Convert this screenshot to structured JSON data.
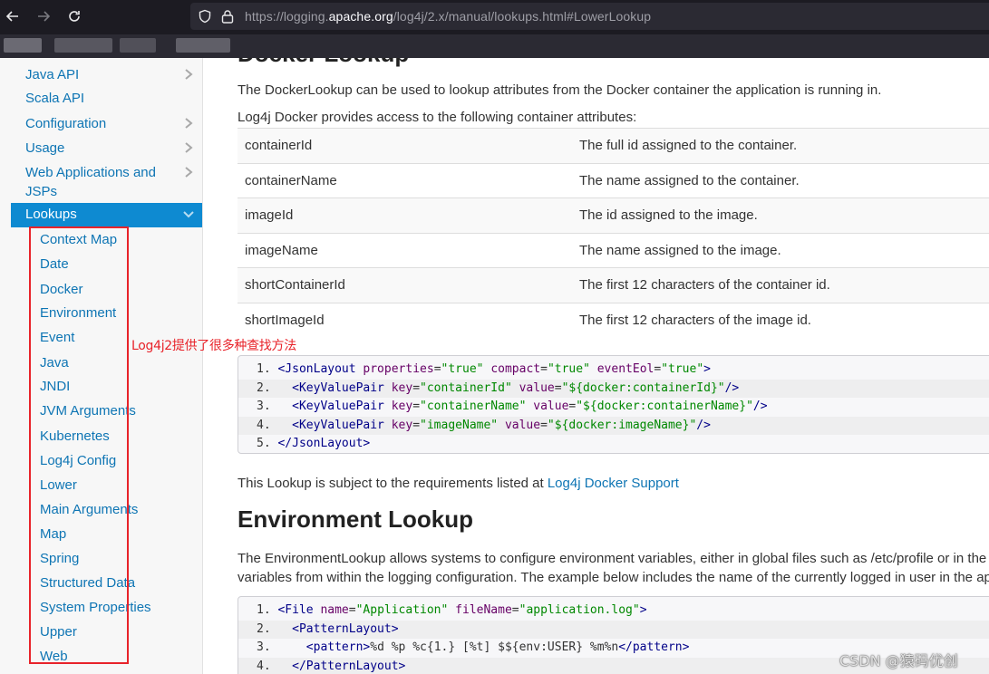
{
  "browser": {
    "url_prefix": "https://logging.",
    "url_domain": "apache.org",
    "url_path": "/log4j/2.x/manual/lookups.html#LowerLookup"
  },
  "sidebar": {
    "items": [
      {
        "label": "Java API",
        "chevron": true
      },
      {
        "label": "Scala API",
        "chevron": false
      },
      {
        "label": "Configuration",
        "chevron": true
      },
      {
        "label": "Usage",
        "chevron": true
      },
      {
        "label": "Web Applications and JSPs",
        "chevron": true
      }
    ],
    "active_item": "Lookups",
    "sub_items": [
      "Context Map",
      "Date",
      "Docker",
      "Environment",
      "Event",
      "Java",
      "JNDI",
      "JVM Arguments",
      "Kubernetes",
      "Log4j Config",
      "Lower",
      "Main Arguments",
      "Map",
      "Spring",
      "Structured Data",
      "System Properties",
      "Upper",
      "Web"
    ]
  },
  "annotation": "Log4j2提供了很多种查找方法",
  "content": {
    "cut_heading": "Docker Lookup",
    "intro": "The DockerLookup can be used to lookup attributes from the Docker container the application is running in.",
    "attrs_intro": "Log4j Docker provides access to the following container attributes:",
    "attributes": [
      {
        "name": "containerId",
        "desc": "The full id assigned to the container."
      },
      {
        "name": "containerName",
        "desc": "The name assigned to the container."
      },
      {
        "name": "imageId",
        "desc": "The id assigned to the image."
      },
      {
        "name": "imageName",
        "desc": "The name assigned to the image."
      },
      {
        "name": "shortContainerId",
        "desc": "The first 12 characters of the container id."
      },
      {
        "name": "shortImageId",
        "desc": "The first 12 characters of the image id."
      }
    ],
    "requirements_text": "This Lookup is subject to the requirements listed at ",
    "requirements_link": "Log4j Docker Support",
    "env_heading": "Environment Lookup",
    "env_para1": "The EnvironmentLookup allows systems to configure environment variables, either in global files such as /etc/profile or in the sta",
    "env_para2": "variables from within the logging configuration. The example below includes the name of the currently logged in user in the applic"
  },
  "watermark": "CSDN @猿码优创"
}
